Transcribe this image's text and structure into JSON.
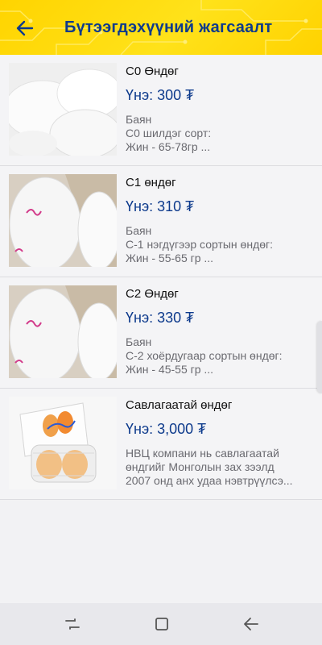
{
  "appbar": {
    "title": "Бүтээгдэхүүний жагсаалт",
    "back_icon": "arrow-left-icon",
    "background": "#ffd400",
    "title_color": "#0d3a8c"
  },
  "products": [
    {
      "name": "С0 Өндөг",
      "price": "Үнэ: 300 ₮",
      "desc": [
        "Баян",
        "С0 шилдэг сорт:",
        "Жин - 65-78гр ..."
      ]
    },
    {
      "name": "С1 өндөг",
      "price": "Үнэ: 310 ₮",
      "desc": [
        "Баян",
        "С-1 нэгдүгээр сортын өндөг:",
        "Жин - 55-65 гр ..."
      ]
    },
    {
      "name": "С2 Өндөг",
      "price": "Үнэ: 330 ₮",
      "desc": [
        "Баян",
        "С-2 хоёрдугаар сортын өндөг:",
        "Жин - 45-55 гр ..."
      ]
    },
    {
      "name": "Савлагаатай өндөг",
      "price": "Үнэ: 3,000 ₮",
      "desc": [
        "НВЦ компани нь савлагаатай",
        "өндгийг Монголын зах зээлд",
        "2007 онд анх удаа нэвтрүүлсэ..."
      ]
    }
  ],
  "navbar": {
    "icons": [
      "recent-apps-icon",
      "home-icon",
      "back-icon"
    ]
  }
}
